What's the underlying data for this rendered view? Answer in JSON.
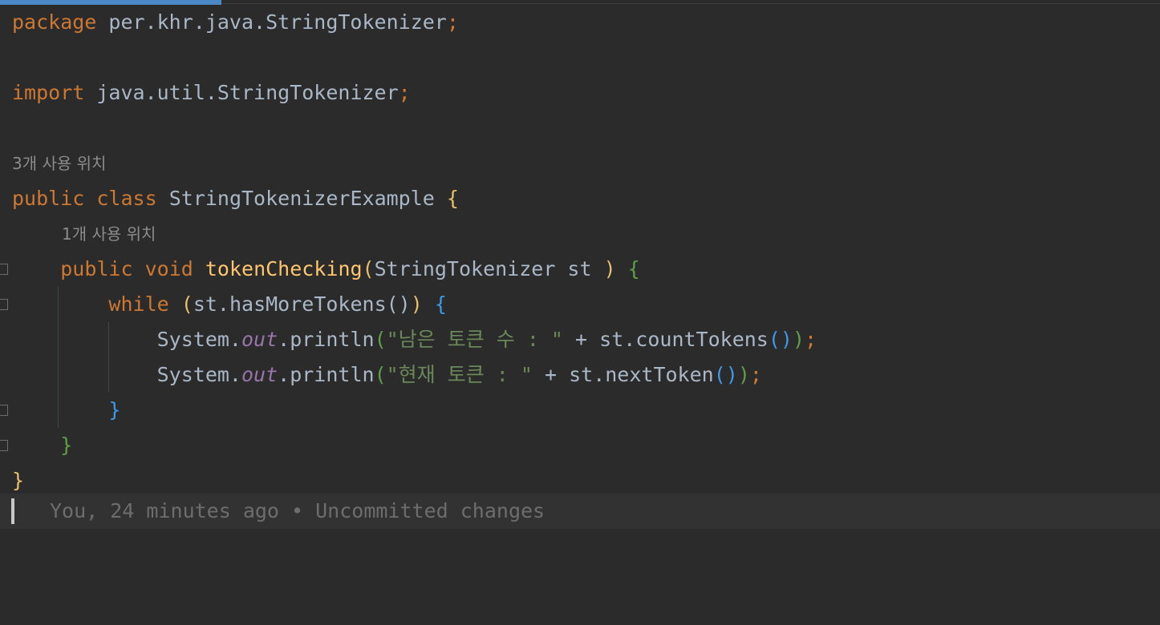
{
  "editor": {
    "lines": {
      "l1": {
        "kw": "package",
        "rest": " per.khr.java.StringTokenizer",
        "semi": ";"
      },
      "l3": {
        "kw": "import",
        "rest": " java.util.StringTokenizer",
        "semi": ";"
      },
      "usage_class": "3개 사용 위치",
      "l5": {
        "kw1": "public",
        "kw2": "class",
        "name": " StringTokenizerExample ",
        "brace": "{"
      },
      "usage_method": "1개 사용 위치",
      "l6": {
        "kw1": "public",
        "kw2": "void",
        "fn": "tokenChecking",
        "paren_open": "(",
        "params": "StringTokenizer st ",
        "paren_close": ")",
        "brace": "{"
      },
      "l7": {
        "kw": "while",
        "paren_open": "(",
        "cond": "st.hasMoreTokens()",
        "paren_close": ")",
        "brace": "{"
      },
      "l8": {
        "sys": "System.",
        "field": "out",
        "call": ".println",
        "po": "(",
        "str": "\"남은 토큰 수 : \"",
        "plus": " + st.countTokens",
        "inner": "()",
        "pc": ")",
        "semi": ";"
      },
      "l9": {
        "sys": "System.",
        "field": "out",
        "call": ".println",
        "po": "(",
        "str": "\"현재 토큰 : \"",
        "plus": " + st.nextToken",
        "inner": "()",
        "pc": ")",
        "semi": ";"
      },
      "l10": {
        "brace": "}"
      },
      "l11": {
        "brace": "}"
      },
      "l12": {
        "brace": "}"
      }
    },
    "blame": "You, 24 minutes ago • Uncommitted changes"
  }
}
